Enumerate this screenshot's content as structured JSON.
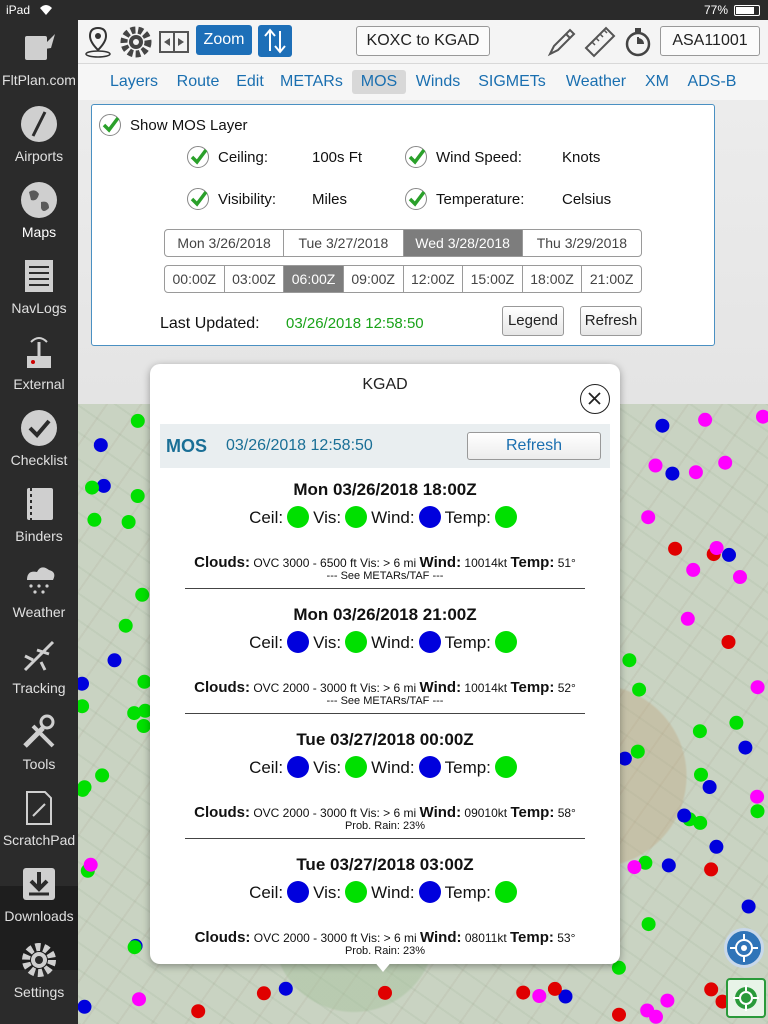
{
  "status_bar": {
    "device": "iPad",
    "battery": "77%"
  },
  "sidebar": {
    "items": [
      {
        "label": "FltPlan.com",
        "icon": "fltplan-icon"
      },
      {
        "label": "Airports",
        "icon": "airport-icon"
      },
      {
        "label": "Maps",
        "icon": "globe-icon"
      },
      {
        "label": "NavLogs",
        "icon": "navlog-icon"
      },
      {
        "label": "External",
        "icon": "router-icon"
      },
      {
        "label": "Checklist",
        "icon": "check-icon"
      },
      {
        "label": "Binders",
        "icon": "binder-icon"
      },
      {
        "label": "Weather",
        "icon": "cloud-rain-icon"
      },
      {
        "label": "Tracking",
        "icon": "plane-icon"
      },
      {
        "label": "Tools",
        "icon": "tools-icon"
      },
      {
        "label": "ScratchPad",
        "icon": "scratchpad-icon"
      },
      {
        "label": "Downloads",
        "icon": "download-icon"
      },
      {
        "label": "Settings",
        "icon": "gear-icon"
      }
    ],
    "active": "Maps"
  },
  "toolbar": {
    "zoom_label": "Zoom",
    "route_label": "KOXC to KGAD",
    "account_label": "ASA11001"
  },
  "tabs": [
    {
      "label": "Layers",
      "active": false
    },
    {
      "label": "Route",
      "active": false
    },
    {
      "label": "Edit",
      "active": false
    },
    {
      "label": "METARs",
      "active": false
    },
    {
      "label": "MOS",
      "active": true
    },
    {
      "label": "Winds",
      "active": false
    },
    {
      "label": "SIGMETs",
      "active": false
    },
    {
      "label": "Weather",
      "active": false
    },
    {
      "label": "XM",
      "active": false
    },
    {
      "label": "ADS-B",
      "active": false
    }
  ],
  "mos_panel": {
    "show_layer_label": "Show MOS Layer",
    "options": [
      {
        "label": "Ceiling:",
        "value": "100s Ft"
      },
      {
        "label": "Wind Speed:",
        "value": "Knots"
      },
      {
        "label": "Visibility:",
        "value": "Miles"
      },
      {
        "label": "Temperature:",
        "value": "Celsius"
      }
    ],
    "dates": [
      "Mon 3/26/2018",
      "Tue 3/27/2018",
      "Wed 3/28/2018",
      "Thu 3/29/2018"
    ],
    "selected_date": 2,
    "times": [
      "00:00Z",
      "03:00Z",
      "06:00Z",
      "09:00Z",
      "12:00Z",
      "15:00Z",
      "18:00Z",
      "21:00Z"
    ],
    "selected_time": 2,
    "last_updated_label": "Last Updated:",
    "last_updated_value": "03/26/2018 12:58:50",
    "legend_label": "Legend",
    "refresh_label": "Refresh"
  },
  "popup": {
    "title": "KGAD",
    "header_label": "MOS",
    "header_time": "03/26/2018 12:58:50",
    "refresh_label": "Refresh",
    "labels": {
      "ceil": "Ceil:",
      "vis": "Vis:",
      "wind": "Wind:",
      "temp": "Temp:",
      "clouds": "Clouds:",
      "wind_b": "Wind:",
      "temp_b": "Temp:"
    },
    "forecasts": [
      {
        "title": "Mon 03/26/2018 18:00Z",
        "ceil_color": "#00e000",
        "vis_color": "#00e000",
        "wind_color": "#0000dd",
        "temp_color": "#00e000",
        "clouds": "OVC 3000 - 6500 ft Vis: > 6 mi",
        "wind": "10014kt",
        "temp": "51°",
        "note": "--- See METARs/TAF ---"
      },
      {
        "title": "Mon 03/26/2018 21:00Z",
        "ceil_color": "#0000dd",
        "vis_color": "#00e000",
        "wind_color": "#0000dd",
        "temp_color": "#00e000",
        "clouds": "OVC 2000 - 3000 ft Vis: > 6 mi",
        "wind": "10014kt",
        "temp": "52°",
        "note": "--- See METARs/TAF ---"
      },
      {
        "title": "Tue 03/27/2018 00:00Z",
        "ceil_color": "#0000dd",
        "vis_color": "#00e000",
        "wind_color": "#0000dd",
        "temp_color": "#00e000",
        "clouds": "OVC 2000 - 3000 ft Vis: > 6 mi",
        "wind": "09010kt",
        "temp": "58°",
        "note": "Prob. Rain: 23%"
      },
      {
        "title": "Tue 03/27/2018 03:00Z",
        "ceil_color": "#0000dd",
        "vis_color": "#00e000",
        "wind_color": "#0000dd",
        "temp_color": "#00e000",
        "clouds": "OVC 2000 - 3000 ft Vis: > 6 mi",
        "wind": "08011kt",
        "temp": "53°",
        "note": "Prob. Rain: 23%"
      }
    ]
  },
  "colors": {
    "accent": "#1a6fb0",
    "mos_green": "#00e000",
    "mos_blue": "#0000dd",
    "mos_red": "#e00000",
    "mos_magenta": "#ff00ff",
    "updated_green": "#1aa31a"
  }
}
